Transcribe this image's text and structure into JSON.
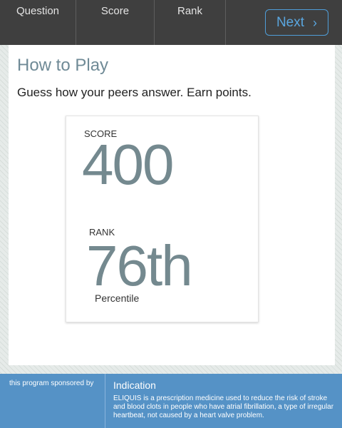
{
  "nav": {
    "tabs": [
      {
        "label": "Question"
      },
      {
        "label": "Score"
      },
      {
        "label": "Rank"
      }
    ],
    "next_label": "Next",
    "next_icon": "chevron-right-icon"
  },
  "main": {
    "title": "How to Play",
    "subtitle": "Guess how your peers answer.  Earn points.",
    "score_label": "SCORE",
    "score_value": "400",
    "rank_label": "RANK",
    "rank_value": "76th",
    "percentile_label": "Percentile"
  },
  "footer": {
    "sponsor_text": "this program sponsored by",
    "indication_title": "Indication",
    "indication_text": "ELIQUIS is a prescription medicine used to reduce the risk of stroke and blood clots in people who have atrial fibrillation, a type of irregular heartbeat, not caused by a heart valve problem."
  },
  "colors": {
    "topbar": "#3f3f3f",
    "accent": "#5aa6df",
    "stat_value": "#74898f",
    "title": "#6f8a96",
    "footer": "#5592c6"
  }
}
